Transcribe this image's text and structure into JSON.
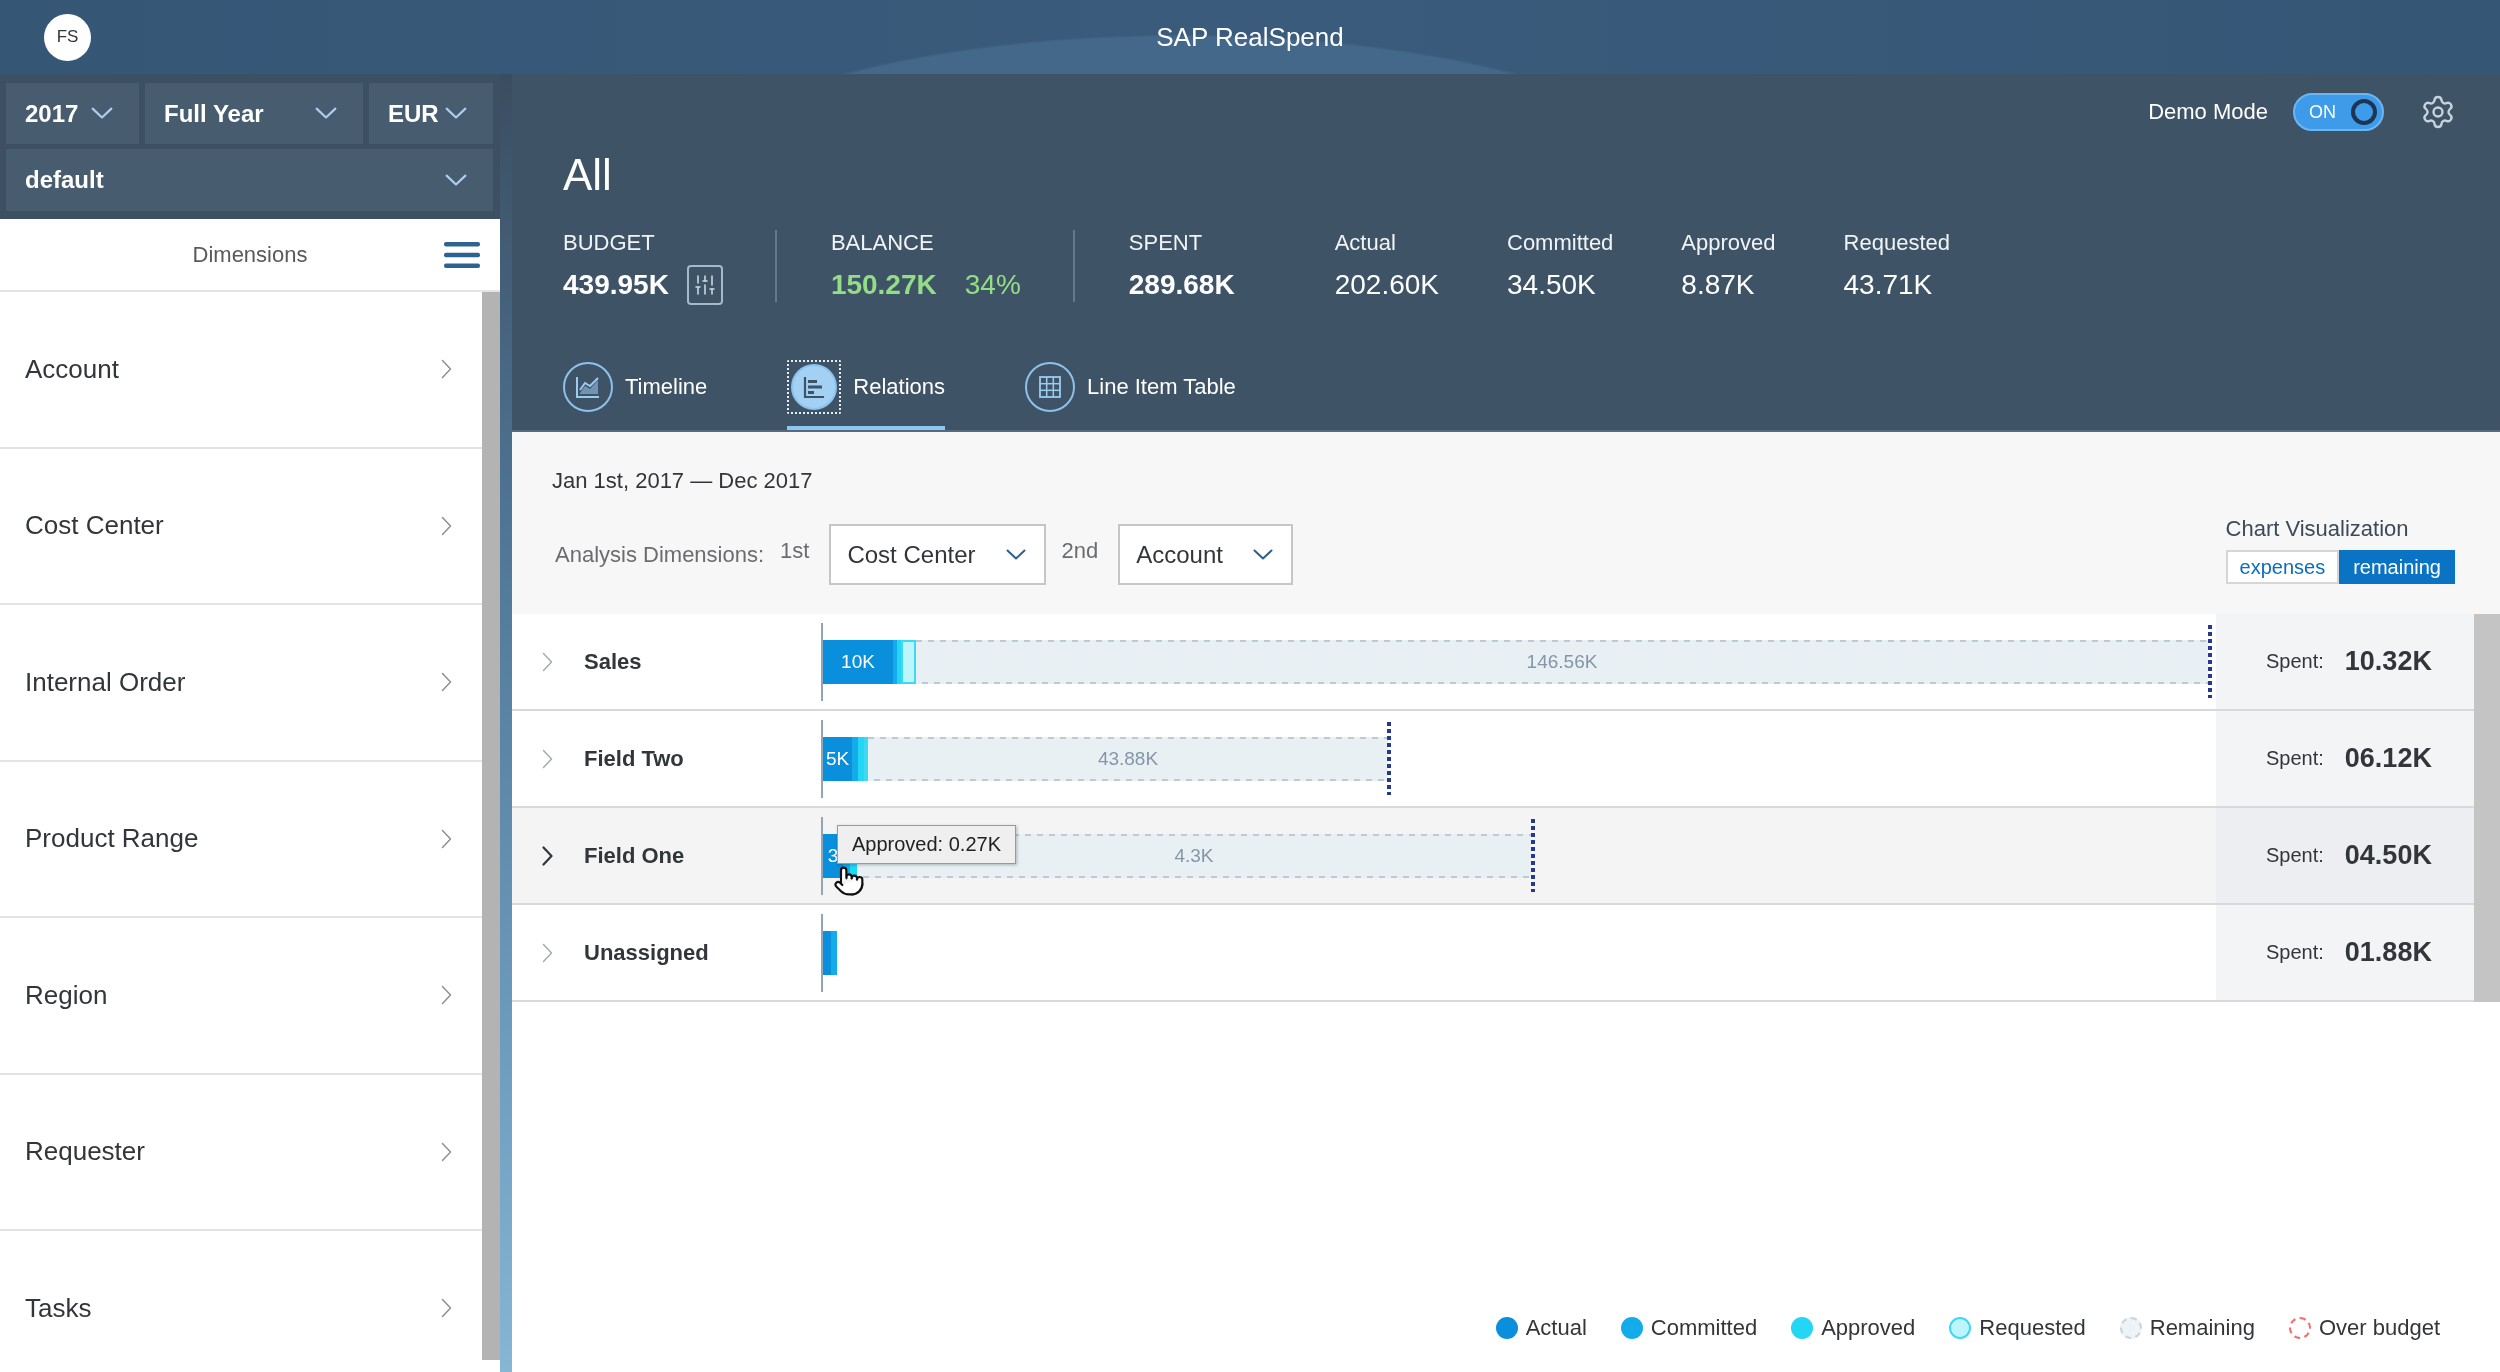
{
  "header": {
    "avatar": "FS",
    "title": "SAP RealSpend"
  },
  "filters": [
    "2017",
    "Full Year",
    "EUR",
    "default"
  ],
  "dimensions": {
    "title": "Dimensions",
    "items": [
      "Account",
      "Cost Center",
      "Internal Order",
      "Product Range",
      "Region",
      "Requester",
      "Tasks"
    ]
  },
  "demo_mode": {
    "label": "Demo Mode",
    "on": true,
    "state_label": "ON"
  },
  "heading": "All",
  "stats": [
    {
      "kind": "budget",
      "label": "BUDGET",
      "value": "439.95K"
    },
    {
      "kind": "balance",
      "label": "BALANCE",
      "value": "150.27K",
      "percent": "34%"
    },
    {
      "kind": "spent",
      "label": "SPENT",
      "value": "289.68K"
    },
    {
      "kind": "detail",
      "label": "Actual",
      "value": "202.60K"
    },
    {
      "kind": "detail",
      "label": "Committed",
      "value": "34.50K"
    },
    {
      "kind": "detail",
      "label": "Approved",
      "value": "8.87K"
    },
    {
      "kind": "detail",
      "label": "Requested",
      "value": "43.71K"
    }
  ],
  "tabs": [
    {
      "label": "Timeline",
      "selected": false
    },
    {
      "label": "Relations",
      "selected": true
    },
    {
      "label": "Line Item Table",
      "selected": false
    }
  ],
  "date_range": "Jan 1st, 2017 — Dec 2017",
  "analysis": {
    "label": "Analysis Dimensions:",
    "first_label": "1st",
    "first": "Cost Center",
    "second_label": "2nd",
    "second": "Account"
  },
  "chart_visualization": {
    "title": "Chart Visualization",
    "options": [
      {
        "label": "expenses",
        "selected": false
      },
      {
        "label": "remaining",
        "selected": true
      }
    ]
  },
  "rows": [
    {
      "name": "Sales",
      "highlighted": false,
      "segments": [
        {
          "kind": "actual",
          "level": 0.05,
          "label": "10K"
        },
        {
          "kind": "committed",
          "level": 0.003
        },
        {
          "kind": "approved",
          "level": 0.003
        },
        {
          "kind": "requested",
          "level": 0.011
        }
      ],
      "budget": {
        "level": 0.996,
        "remaining_label": "146.56K"
      },
      "spent_label": "Spent:",
      "spent": "10.32K"
    },
    {
      "name": "Field Two",
      "highlighted": false,
      "segments": [
        {
          "kind": "actual",
          "level": 0.021,
          "label": "5K"
        },
        {
          "kind": "committed",
          "level": 0.004
        },
        {
          "kind": "approved",
          "level": 0.004
        },
        {
          "kind": "requested",
          "level": 0.002
        }
      ],
      "budget": {
        "level": 0.406,
        "remaining_label": "43.88K"
      },
      "spent_label": "Spent:",
      "spent": "06.12K"
    },
    {
      "name": "Field One",
      "highlighted": true,
      "segments": [
        {
          "kind": "actual",
          "level": 0.014,
          "label": "3"
        },
        {
          "kind": "committed",
          "level": 0.005
        },
        {
          "kind": "approved",
          "level": 0.005
        }
      ],
      "budget": {
        "level": 0.51,
        "remaining_label": "4.3K"
      },
      "tooltip": "Approved: 0.27K",
      "spent_label": "Spent:",
      "spent": "04.50K"
    },
    {
      "name": "Unassigned",
      "highlighted": false,
      "segments": [
        {
          "kind": "actual",
          "level": 0.006
        },
        {
          "kind": "committed",
          "level": 0.004
        }
      ],
      "spent_label": "Spent:",
      "spent": "01.88K"
    }
  ],
  "legend": [
    {
      "kind": "actual",
      "label": "Actual"
    },
    {
      "kind": "committed",
      "label": "Committed"
    },
    {
      "kind": "approved",
      "label": "Approved"
    },
    {
      "kind": "requested",
      "label": "Requested"
    },
    {
      "kind": "remaining",
      "label": "Remaining"
    },
    {
      "kind": "over_budget",
      "label": "Over budget"
    }
  ]
}
